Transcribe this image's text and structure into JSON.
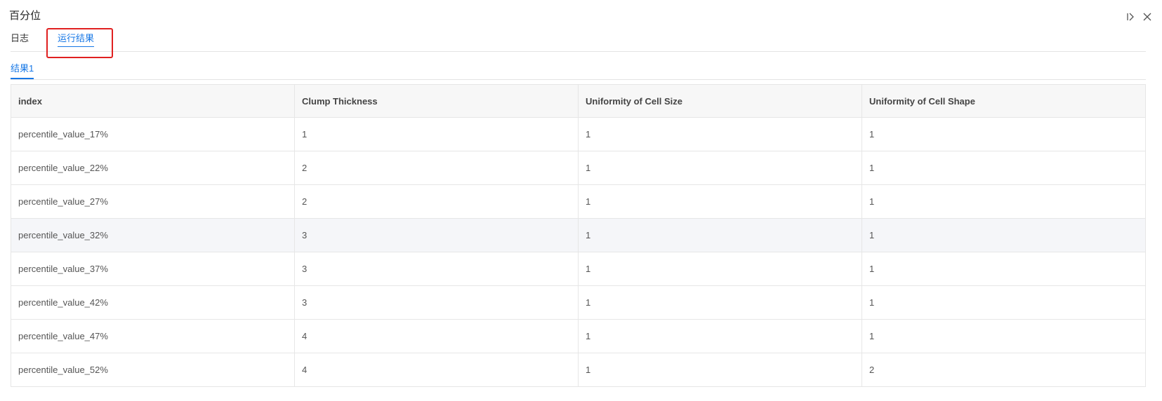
{
  "panel": {
    "title": "百分位"
  },
  "tabs": [
    {
      "label": "日志",
      "active": false
    },
    {
      "label": "运行结果",
      "active": true
    }
  ],
  "subtabs": [
    {
      "label": "结果1",
      "active": true
    }
  ],
  "table": {
    "columns": [
      "index",
      "Clump Thickness",
      "Uniformity of Cell Size",
      "Uniformity of Cell Shape"
    ],
    "rows": [
      [
        "percentile_value_17%",
        "1",
        "1",
        "1"
      ],
      [
        "percentile_value_22%",
        "2",
        "1",
        "1"
      ],
      [
        "percentile_value_27%",
        "2",
        "1",
        "1"
      ],
      [
        "percentile_value_32%",
        "3",
        "1",
        "1"
      ],
      [
        "percentile_value_37%",
        "3",
        "1",
        "1"
      ],
      [
        "percentile_value_42%",
        "3",
        "1",
        "1"
      ],
      [
        "percentile_value_47%",
        "4",
        "1",
        "1"
      ],
      [
        "percentile_value_52%",
        "4",
        "1",
        "2"
      ]
    ],
    "hovered_row": 3
  },
  "icons": {
    "collapse": "collapse-panel-icon",
    "close": "close-icon"
  },
  "colors": {
    "accent": "#1677e6",
    "highlight": "#e02020",
    "header_bg": "#f7f7f7",
    "hover_bg": "#f5f6f9"
  }
}
